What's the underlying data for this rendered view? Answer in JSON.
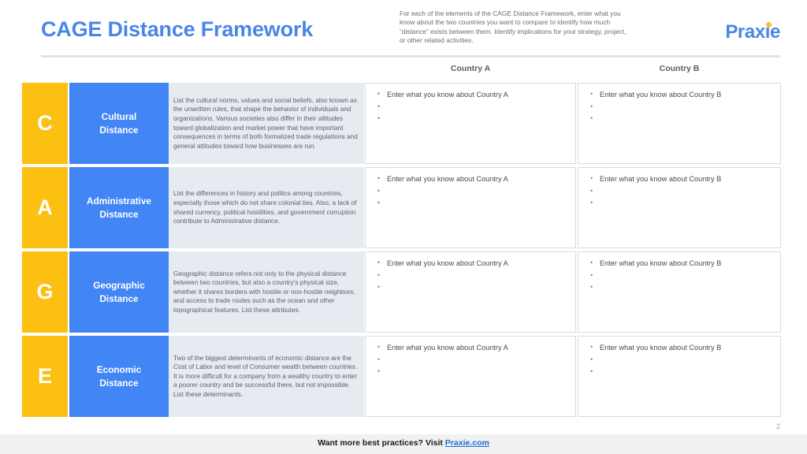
{
  "header": {
    "title": "CAGE Distance Framework",
    "intro": "For each of the elements of the CAGE Distance Framework, enter what you know about the two countries you want to compare to identify how much “distance” exists between them. Identify implications for your strategy, project, or other related activities.",
    "brand": "Praxie",
    "brand_dot_icon": "dot-icon"
  },
  "columns": {
    "country_a": "Country A",
    "country_b": "Country B"
  },
  "rows": [
    {
      "letter": "C",
      "name": "Cultural\nDistance",
      "name_line1": "Cultural",
      "name_line2": "Distance",
      "description": "List the cultural norms, values and social beliefs, also known as the unwritten rules, that shape the behavior of individuals and organizations. Various societies also differ in their attitudes toward globalization and market power that have important consequences in terms of both formalized trade regulations and general attitudes toward how businesses are run.",
      "entry_a": [
        "Enter what you know about Country A",
        "",
        ""
      ],
      "entry_b": [
        "Enter what you know about Country B",
        "",
        ""
      ]
    },
    {
      "letter": "A",
      "name_line1": "Administrative",
      "name_line2": "Distance",
      "description": "List the differences in history and politics among countries, especially those which do not share colonial ties. Also, a lack of shared currency, political hostilities, and government corruption contribute to Administrative distance.",
      "entry_a": [
        "Enter what you know about Country A",
        "",
        ""
      ],
      "entry_b": [
        "Enter what you know about Country B",
        "",
        ""
      ]
    },
    {
      "letter": "G",
      "name_line1": "Geographic",
      "name_line2": "Distance",
      "description": "Geographic distance refers not only to the physical distance between two countries, but also a country’s physical size, whether it shares borders with hostile or non-hostile neighbors, and access to trade routes such as the ocean and other topographical features. List these attributes.",
      "entry_a": [
        "Enter what you know about Country A",
        "",
        ""
      ],
      "entry_b": [
        "Enter what you know about Country B",
        "",
        ""
      ]
    },
    {
      "letter": "E",
      "name_line1": "Economic",
      "name_line2": "Distance",
      "description": "Two of the biggest determinants of economic distance are the Cost of Labor and level of Consumer wealth between countries. It is more difficult for a company from a wealthy country to enter a poorer country and be successful there, but not impossible. List these determinants.",
      "entry_a": [
        "Enter what you know about Country A",
        "",
        ""
      ],
      "entry_b": [
        "Enter what you know about Country B",
        "",
        ""
      ]
    }
  ],
  "footer": {
    "page_number": "2",
    "text_before": "Want more best practices? Visit ",
    "link": "Praxie.com"
  },
  "colors": {
    "accent_blue": "#4285f4",
    "title_blue": "#4a86e8",
    "accent_yellow": "#fbc011",
    "desc_background": "#e6ebf2",
    "footer_background": "#f1f1f1",
    "link_blue": "#1a6fd4"
  }
}
